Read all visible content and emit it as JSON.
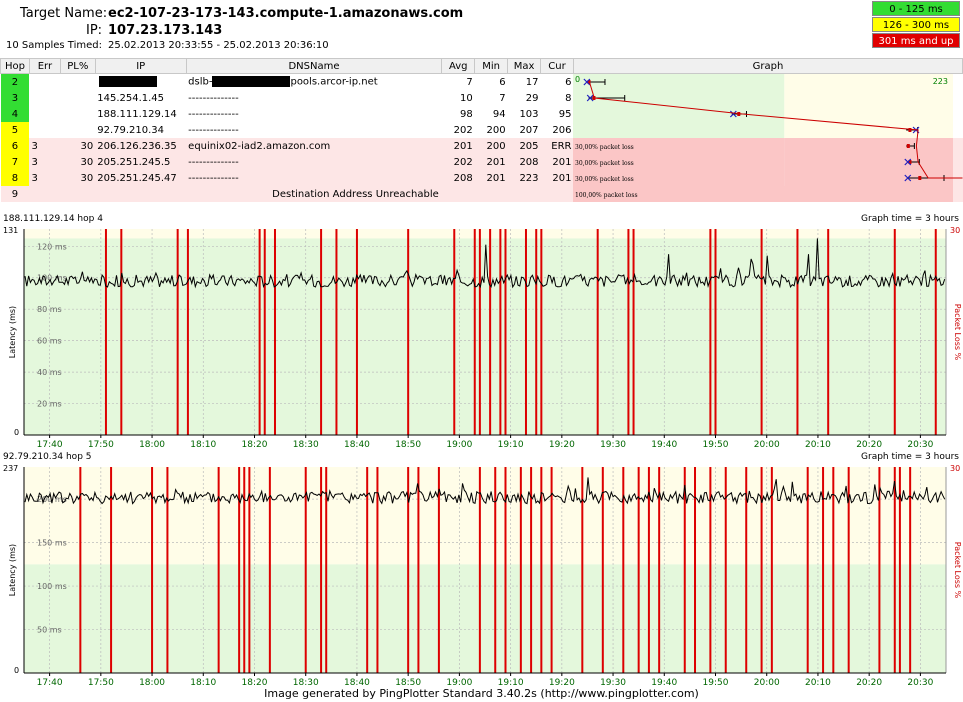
{
  "header": {
    "target_label": "Target Name:",
    "target_value": "ec2-107-23-173-143.compute-1.amazonaws.com",
    "ip_label": "IP:",
    "ip_value": "107.23.173.143",
    "samples_label": "10 Samples Timed:",
    "samples_value": "25.02.2013 20:33:55 - 25.02.2013 20:36:10"
  },
  "legend": [
    {
      "label": "0 - 125 ms",
      "bg": "#33dd33",
      "fg": "#000000"
    },
    {
      "label": "126 - 300 ms",
      "bg": "#ffff00",
      "fg": "#000000"
    },
    {
      "label": "301 ms and up",
      "bg": "#e00000",
      "fg": "#ffffff"
    }
  ],
  "table": {
    "columns": [
      "Hop",
      "Err",
      "PL%",
      "IP",
      "DNSName",
      "Avg",
      "Min",
      "Max",
      "Cur",
      "Graph"
    ],
    "graph_max_label": "223",
    "graph_zero_label": "0",
    "rows": [
      {
        "hop": "2",
        "err": "",
        "pl": "",
        "ip": "",
        "ip_redacted": true,
        "dns_prefix": "dslb-",
        "dns_suffix": "pools.arcor-ip.net",
        "dns_redacted": true,
        "avg": "7",
        "min": "6",
        "max": "17",
        "cur": "6",
        "hop_color": "#33dd33",
        "loss_text": "",
        "avg_val": 7,
        "min_val": 6,
        "max_val": 17,
        "cur_val": 6
      },
      {
        "hop": "3",
        "err": "",
        "pl": "",
        "ip": "145.254.1.45",
        "dns_prefix": "--------------",
        "dns_suffix": "",
        "avg": "10",
        "min": "7",
        "max": "29",
        "cur": "8",
        "hop_color": "#33dd33",
        "loss_text": "",
        "avg_val": 10,
        "min_val": 7,
        "max_val": 29,
        "cur_val": 8
      },
      {
        "hop": "4",
        "err": "",
        "pl": "",
        "ip": "188.111.129.14",
        "dns_prefix": "--------------",
        "dns_suffix": "",
        "avg": "98",
        "min": "94",
        "max": "103",
        "cur": "95",
        "hop_color": "#33dd33",
        "loss_text": "",
        "avg_val": 98,
        "min_val": 94,
        "max_val": 103,
        "cur_val": 95
      },
      {
        "hop": "5",
        "err": "",
        "pl": "",
        "ip": "92.79.210.34",
        "dns_prefix": "--------------",
        "dns_suffix": "",
        "avg": "202",
        "min": "200",
        "max": "207",
        "cur": "206",
        "hop_color": "#ffff00",
        "loss_text": "",
        "avg_val": 202,
        "min_val": 200,
        "max_val": 207,
        "cur_val": 206
      },
      {
        "hop": "6",
        "err": "3",
        "pl": "30",
        "ip": "206.126.236.35",
        "dns_prefix": "equinix02-iad2.amazon.com",
        "dns_suffix": "",
        "avg": "201",
        "min": "200",
        "max": "205",
        "cur": "ERR",
        "hop_color": "#ffff00",
        "loss_text": "30,00% packet loss",
        "avg_val": 201,
        "min_val": 200,
        "max_val": 205,
        "cur_val": null
      },
      {
        "hop": "7",
        "err": "3",
        "pl": "30",
        "ip": "205.251.245.5",
        "dns_prefix": "--------------",
        "dns_suffix": "",
        "avg": "202",
        "min": "201",
        "max": "208",
        "cur": "201",
        "hop_color": "#ffff00",
        "loss_text": "30,00% packet loss",
        "avg_val": 202,
        "min_val": 201,
        "max_val": 208,
        "cur_val": 201
      },
      {
        "hop": "8",
        "err": "3",
        "pl": "30",
        "ip": "205.251.245.47",
        "dns_prefix": "--------------",
        "dns_suffix": "",
        "avg": "208",
        "min": "201",
        "max": "223",
        "cur": "201",
        "hop_color": "#ffff00",
        "loss_text": "30,00% packet loss",
        "avg_val": 208,
        "min_val": 201,
        "max_val": 223,
        "cur_val": 201
      }
    ],
    "unreachable": {
      "hop": "9",
      "text": "Destination Address Unreachable",
      "loss_text": "100,00% packet loss"
    }
  },
  "chart_data": [
    {
      "type": "line",
      "title": "188.111.129.14 hop 4",
      "right_title": "Graph time = 3 hours",
      "ylabel": "Latency (ms)",
      "y2label": "Packet Loss %",
      "y2_max_label": "30",
      "ylim": [
        0,
        131
      ],
      "y_max_label": "131",
      "y_zero_label": "0",
      "y_ticks": [
        {
          "v": 120,
          "label": "120 ms"
        },
        {
          "v": 100,
          "label": "100 ms"
        },
        {
          "v": 80,
          "label": "80 ms"
        },
        {
          "v": 60,
          "label": "60 ms"
        },
        {
          "v": 40,
          "label": "40 ms"
        },
        {
          "v": 20,
          "label": "20 ms"
        }
      ],
      "green_max": 125,
      "x_labels": [
        "17:40",
        "17:50",
        "18:00",
        "18:10",
        "18:20",
        "18:30",
        "18:40",
        "18:50",
        "19:00",
        "19:10",
        "19:20",
        "19:30",
        "19:40",
        "19:50",
        "20:00",
        "20:10",
        "20:20",
        "20:30"
      ],
      "x_start_min": 1055,
      "x_end_min": 1235,
      "baseline": 98,
      "loss_times": [
        "17:51",
        "17:54",
        "18:05",
        "18:07",
        "18:21",
        "18:22",
        "18:24",
        "18:33",
        "18:36",
        "18:40",
        "18:50",
        "18:59",
        "19:03",
        "19:04",
        "19:06",
        "19:08",
        "19:09",
        "19:13",
        "19:15",
        "19:16",
        "19:27",
        "19:33",
        "19:34",
        "19:49",
        "19:50",
        "19:59",
        "20:06",
        "20:12",
        "20:25",
        "20:33"
      ],
      "spikes": [
        {
          "t": "19:05",
          "v": 121
        },
        {
          "t": "20:10",
          "v": 125
        },
        {
          "t": "20:00",
          "v": 114
        },
        {
          "t": "19:41",
          "v": 115
        },
        {
          "t": "19:57",
          "v": 112
        },
        {
          "t": "20:08",
          "v": 115
        }
      ]
    },
    {
      "type": "line",
      "title": "92.79.210.34 hop 5",
      "right_title": "Graph time = 3 hours",
      "ylabel": "Latency (ms)",
      "y2label": "Packet Loss %",
      "y2_max_label": "30",
      "ylim": [
        0,
        237
      ],
      "y_max_label": "237",
      "y_zero_label": "0",
      "y_ticks": [
        {
          "v": 200,
          "label": "200 ms"
        },
        {
          "v": 150,
          "label": "150 ms"
        },
        {
          "v": 100,
          "label": "100 ms"
        },
        {
          "v": 50,
          "label": "50 ms"
        }
      ],
      "green_max": 125,
      "x_labels": [
        "17:40",
        "17:50",
        "18:00",
        "18:10",
        "18:20",
        "18:30",
        "18:40",
        "18:50",
        "19:00",
        "19:10",
        "19:20",
        "19:30",
        "19:40",
        "19:50",
        "20:00",
        "20:10",
        "20:20",
        "20:30"
      ],
      "x_start_min": 1055,
      "x_end_min": 1235,
      "baseline": 202,
      "loss_times": [
        "17:46",
        "17:52",
        "18:00",
        "18:03",
        "18:13",
        "18:17",
        "18:18",
        "18:19",
        "18:23",
        "18:30",
        "18:33",
        "18:34",
        "18:42",
        "18:44",
        "18:50",
        "18:52",
        "18:56",
        "19:04",
        "19:07",
        "19:09",
        "19:12",
        "19:14",
        "19:16",
        "19:18",
        "19:24",
        "19:28",
        "19:32",
        "19:35",
        "19:37",
        "19:39",
        "19:44",
        "19:46",
        "19:49",
        "19:52",
        "19:56",
        "19:59",
        "20:01",
        "20:08",
        "20:11",
        "20:13",
        "20:16",
        "20:22",
        "20:25",
        "20:26",
        "20:28"
      ],
      "spikes": [
        {
          "t": "20:02",
          "v": 223
        },
        {
          "t": "20:05",
          "v": 220
        },
        {
          "t": "19:25",
          "v": 225
        },
        {
          "t": "18:52",
          "v": 218
        }
      ]
    }
  ],
  "footer": "Image generated by PingPlotter Standard 3.40.2s (http://www.pingplotter.com)"
}
